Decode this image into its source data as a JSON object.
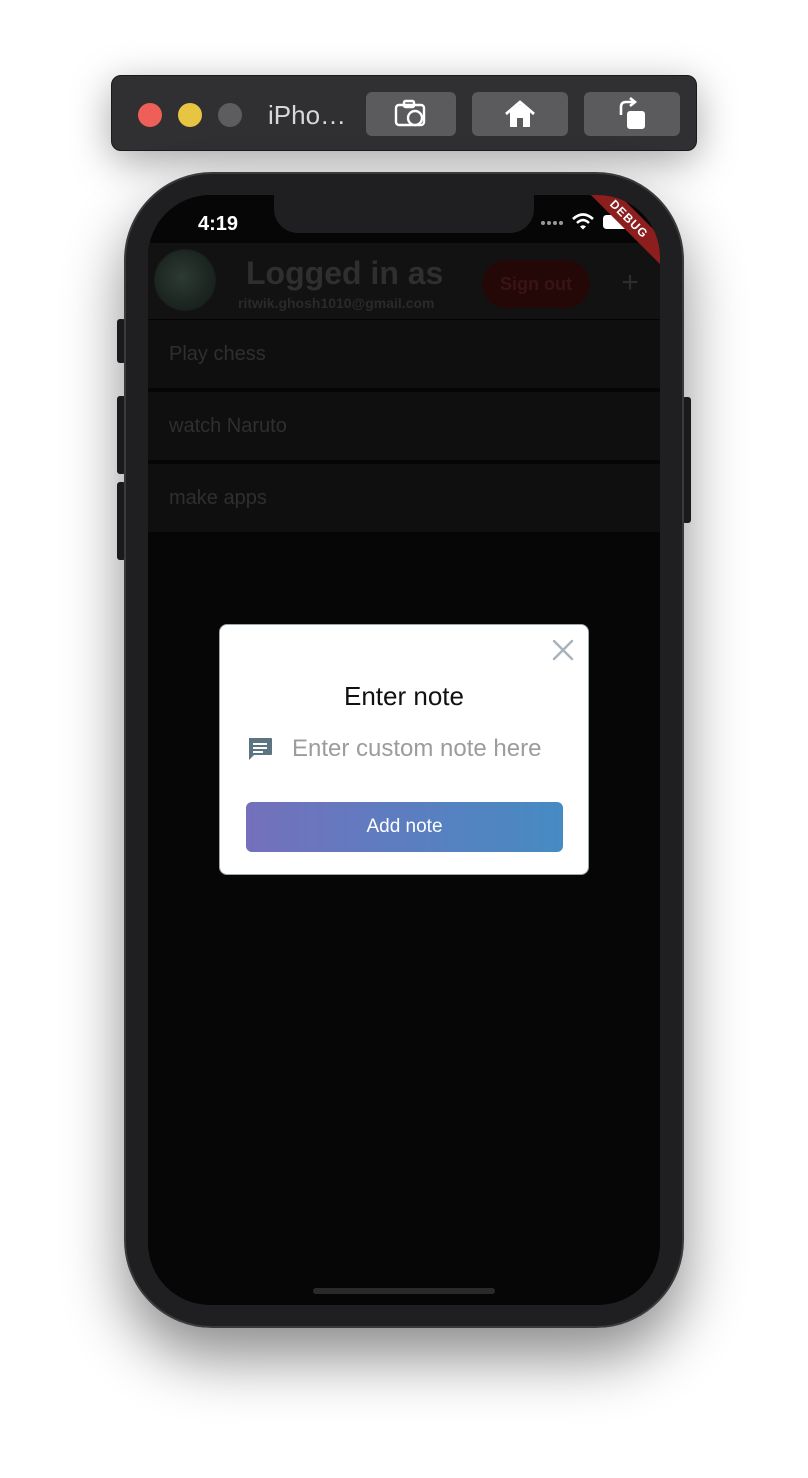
{
  "simulator": {
    "title": "iPho…",
    "icons": [
      "screenshot-icon",
      "home-icon",
      "rotate-icon"
    ]
  },
  "status_bar": {
    "time": "4:19",
    "debug_label": "DEBUG",
    "icons": [
      "signal-icon",
      "wifi-icon",
      "battery-icon"
    ]
  },
  "app_bar": {
    "title": "Logged in as",
    "email": "ritwik.ghosh1010@gmail.com",
    "signout_label": "Sign out",
    "add_label": "+"
  },
  "notes": [
    {
      "text": "Play chess"
    },
    {
      "text": "watch Naruto"
    },
    {
      "text": "make apps"
    }
  ],
  "dialog": {
    "title": "Enter note",
    "input_placeholder": "Enter custom note here",
    "input_value": "",
    "button_label": "Add note"
  },
  "colors": {
    "accent_gradient_start": "#7470bb",
    "accent_gradient_end": "#468bc3",
    "debug_ribbon": "#8c1e1e",
    "traffic_close": "#ee5f57",
    "traffic_minimize": "#e8c443"
  }
}
